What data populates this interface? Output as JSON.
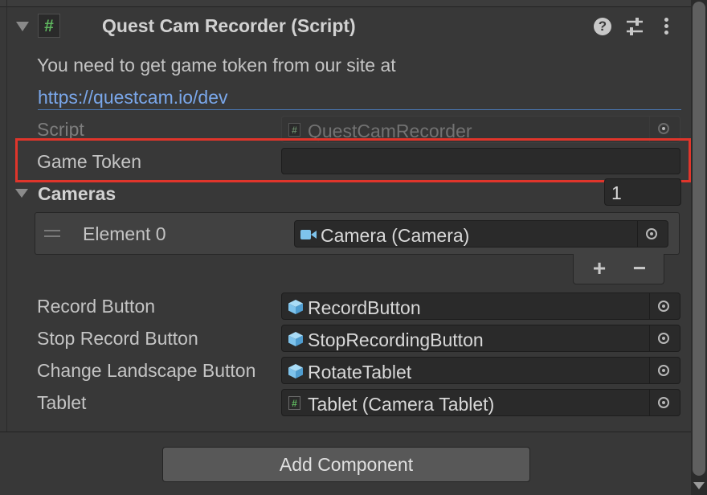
{
  "component": {
    "title": "Quest Cam Recorder (Script)",
    "icons": {
      "fold": "triangle-down-icon",
      "script": "hash-icon",
      "help": "help-icon",
      "presets": "sliders-icon",
      "menu": "kebab-icon"
    },
    "help_glyph": "?",
    "script_glyph": "#"
  },
  "info": {
    "text": "You need to get game token from our site at",
    "link": "https://questcam.io/dev"
  },
  "fields": {
    "script": {
      "label": "Script",
      "value": "QuestCamRecorder"
    },
    "game_token": {
      "label": "Game Token",
      "value": ""
    },
    "cameras": {
      "label": "Cameras",
      "count": "1",
      "elements": [
        {
          "label": "Element 0",
          "value": "Camera (Camera)",
          "icon": "camera-icon"
        }
      ],
      "add_glyph": "+",
      "remove_glyph": "−"
    },
    "record_button": {
      "label": "Record Button",
      "value": "RecordButton",
      "icon": "cube-icon"
    },
    "stop_record_button": {
      "label": "Stop Record Button",
      "value": "StopRecordingButton",
      "icon": "cube-icon"
    },
    "change_landscape_button": {
      "label": "Change Landscape Button",
      "value": "RotateTablet",
      "icon": "cube-icon"
    },
    "tablet": {
      "label": "Tablet",
      "value": "Tablet (Camera Tablet)",
      "icon": "hash-icon"
    }
  },
  "footer": {
    "add_component": "Add Component"
  },
  "colors": {
    "background": "#383838",
    "link": "#7aa7ea",
    "highlight": "#e0352b",
    "field": "#2a2a2a",
    "script_icon": "#5fb85f",
    "cube_icon": "#7ec3ec"
  }
}
